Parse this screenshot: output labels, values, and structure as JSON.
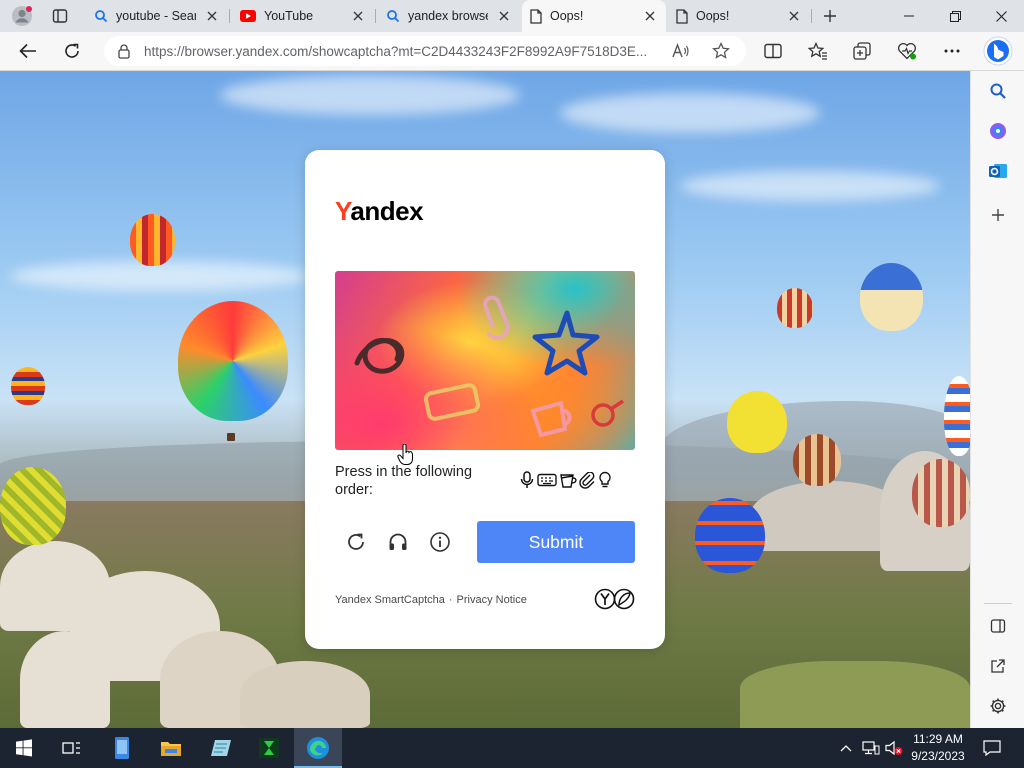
{
  "browser": {
    "tabs": [
      {
        "title": "youtube - Search",
        "icon": "search-icon",
        "active": false
      },
      {
        "title": "YouTube",
        "icon": "youtube-icon",
        "active": false
      },
      {
        "title": "yandex browser",
        "icon": "search-icon",
        "active": false
      },
      {
        "title": "Oops!",
        "icon": "page-icon",
        "active": true
      },
      {
        "title": "Oops!",
        "icon": "page-icon",
        "active": false
      }
    ],
    "address": {
      "url": "https://browser.yandex.com/showcaptcha?mt=C2D4433243F2F8992A9F7518D3E..."
    }
  },
  "captcha": {
    "logo_first": "Y",
    "logo_rest": "andex",
    "instruction": "Press in the following order:",
    "order_icons": [
      "microphone-icon",
      "keyboard-icon",
      "cup-icon",
      "paperclip-icon",
      "lightbulb-icon"
    ],
    "submit_label": "Submit",
    "footer_product": "Yandex SmartCaptcha",
    "footer_separator": "·",
    "footer_privacy": "Privacy Notice",
    "colors": {
      "submit": "#4f86f7",
      "logo_accent": "#fc3f1d"
    }
  },
  "taskbar": {
    "time": "11:29 AM",
    "date": "9/23/2023"
  }
}
